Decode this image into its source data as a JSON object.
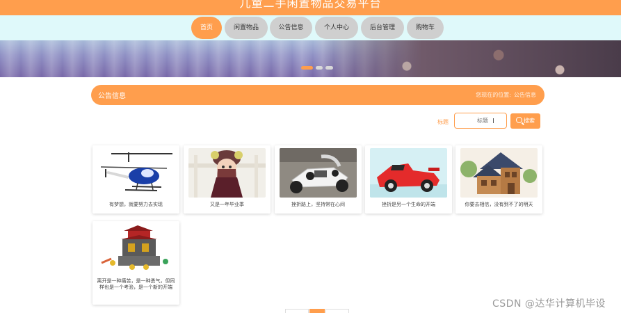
{
  "header": {
    "title": "儿童二手闲置物品交易平台"
  },
  "nav": {
    "items": [
      {
        "label": "首页",
        "active": true
      },
      {
        "label": "闲置物品",
        "active": false
      },
      {
        "label": "公告信息",
        "active": false
      },
      {
        "label": "个人中心",
        "active": false
      },
      {
        "label": "后台管理",
        "active": false
      },
      {
        "label": "购物车",
        "active": false
      }
    ]
  },
  "banner": {
    "slide_count": 3,
    "active_slide": 1
  },
  "section": {
    "title": "公告信息",
    "breadcrumb_prefix": "您现在的位置:",
    "breadcrumb_current": "公告信息"
  },
  "search": {
    "label": "标题",
    "placeholder": "标题",
    "button_label": "搜索"
  },
  "notices": [
    {
      "caption": "有梦想，就要努力去实现",
      "image": "helicopter"
    },
    {
      "caption": "又是一年毕业季",
      "image": "doll"
    },
    {
      "caption": "挫折路上，坚持常在心间",
      "image": "kart"
    },
    {
      "caption": "挫折是另一个生命的开端",
      "image": "race-car"
    },
    {
      "caption": "你要去相信，没有到不了的明天",
      "image": "wooden-house"
    },
    {
      "caption": "离开是一种痛苦，是一种勇气，但同样也是一个考验，是一个新的开端",
      "image": "lego-temple"
    }
  ],
  "pagination": {
    "active_page": 2
  },
  "watermark": "CSDN @达华计算机毕设",
  "colors": {
    "accent": "#ff9e4d",
    "nav_bg": "#dff9fa",
    "nav_button": "#cfcfcf"
  }
}
